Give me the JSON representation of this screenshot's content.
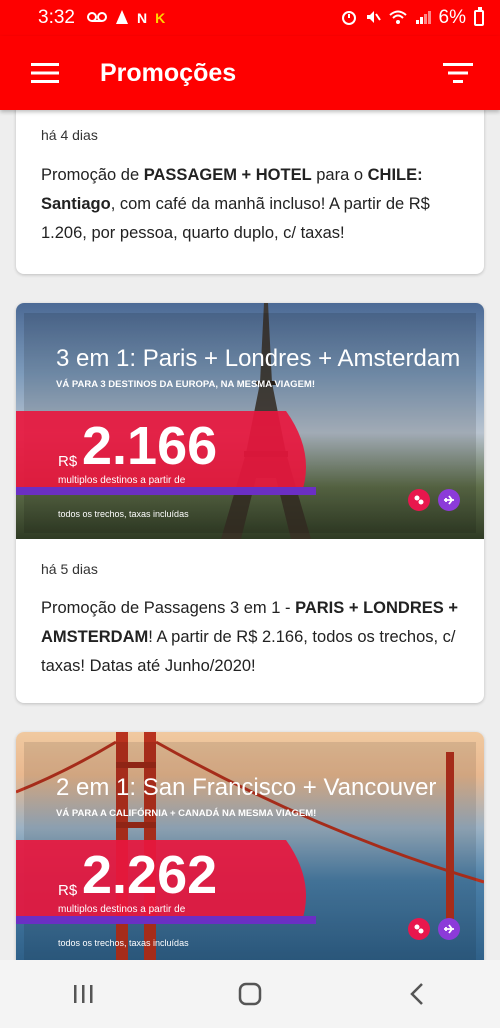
{
  "status": {
    "time": "3:32",
    "notif_labels": [
      "N",
      "K"
    ],
    "battery": "6%"
  },
  "app": {
    "title": "Promoções"
  },
  "cards": [
    {
      "age": "há 4 dias",
      "text_parts": [
        {
          "t": "Promoção de ",
          "b": false
        },
        {
          "t": "PASSAGEM + HOTEL",
          "b": true
        },
        {
          "t": " para o ",
          "b": false
        },
        {
          "t": "CHILE: Santiago",
          "b": true
        },
        {
          "t": ", com café da manhã incluso! A partir de R$ 1.206, por pessoa, quarto duplo, c/ taxas!",
          "b": false
        }
      ]
    },
    {
      "banner": {
        "title": "3 em 1: Paris + Londres + Amsterdam",
        "subtitle": "VÁ PARA 3 DESTINOS DA EUROPA, NA MESMA VIAGEM!",
        "currency": "R$",
        "price": "2.166",
        "caption": "multiplos destinos a partir de",
        "footnote": "todos os trechos, taxas incluídas"
      },
      "age": "há 5 dias",
      "text_parts": [
        {
          "t": "Promoção de Passagens 3 em 1 - ",
          "b": false
        },
        {
          "t": "PARIS + LONDRES + AMSTERDAM",
          "b": true
        },
        {
          "t": "! A partir de R$ 2.166, todos os trechos, c/ taxas! Datas até Junho/2020!",
          "b": false
        }
      ]
    },
    {
      "banner": {
        "title": "2 em 1: San Francisco + Vancouver",
        "subtitle": "VÁ PARA A CALIFÓRNIA + CANADÁ NA MESMA VIAGEM!",
        "currency": "R$",
        "price": "2.262",
        "caption": "multiplos destinos a partir de",
        "footnote": "todos os trechos, taxas incluídas"
      }
    }
  ],
  "colors": {
    "brand_red": "#fe0000",
    "banner_red": "#e8173e",
    "badge_pink": "#e8174d",
    "badge_purple": "#8c3bd9"
  },
  "icons": {
    "menu": "hamburger-menu-icon",
    "filter": "filter-icon",
    "map_badge": "map-pin-icon",
    "plane_badge": "airplane-icon",
    "nav_recent": "recent-apps-icon",
    "nav_home": "home-icon",
    "nav_back": "back-icon"
  }
}
